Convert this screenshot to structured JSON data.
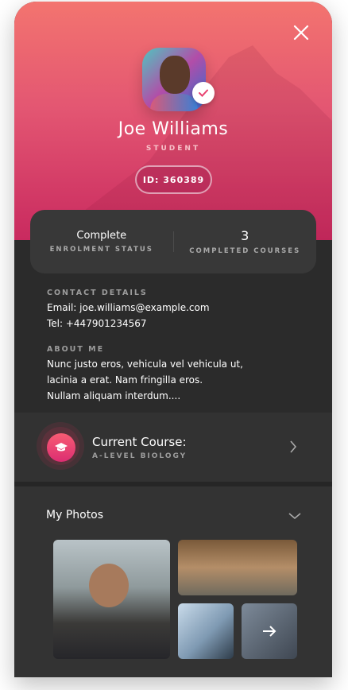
{
  "profile": {
    "name": "Joe Williams",
    "role": "STUDENT",
    "id_label": "ID: 360389",
    "verified": true
  },
  "stats": [
    {
      "value": "Complete",
      "label": "ENROLMENT STATUS"
    },
    {
      "value": "3",
      "label": "COMPLETED COURSES"
    }
  ],
  "contact": {
    "label": "CONTACT DETAILS",
    "email": "Email: joe.williams@example.com",
    "tel": "Tel: +447901234567"
  },
  "about": {
    "label": "ABOUT ME",
    "lines": [
      "Nunc justo eros, vehicula vel vehicula ut,",
      "lacinia a erat. Nam fringilla eros.",
      "Nullam aliquam interdum...."
    ]
  },
  "course": {
    "title": "Current Course:",
    "subtitle": "A-LEVEL BIOLOGY",
    "icon": "graduation-cap-icon"
  },
  "photos": {
    "title": "My Photos",
    "more_icon": "arrow-right-icon"
  },
  "colors": {
    "accent": "#e8416e",
    "header_top": "#f3746f",
    "header_bottom": "#c92a5f",
    "body": "#2b2b2b"
  }
}
